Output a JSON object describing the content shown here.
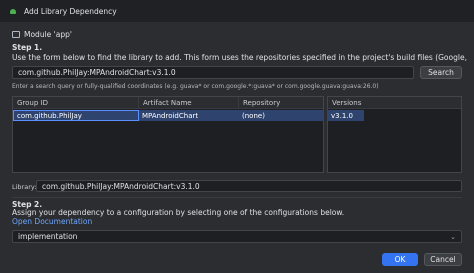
{
  "window": {
    "title": "Add Library Dependency"
  },
  "module": {
    "label": "Module 'app'"
  },
  "step1": {
    "title": "Step 1.",
    "description": "Use the form below to find the library to add. This form uses the repositories specified in the project's build files (Google, Maven Central)",
    "search_value": "com.github.PhilJay:MPAndroidChart:v3.1.0",
    "search_button": "Search",
    "hint": "Enter a search query or fully-qualified coordinates (e.g. guava* or com.google.*:guava* or com.google.guava:guava:26.0)"
  },
  "results": {
    "columns": [
      "Group ID",
      "Artifact Name",
      "Repository"
    ],
    "rows": [
      {
        "group_id": "com.github.PhilJay",
        "artifact": "MPAndroidChart",
        "repository": "(none)"
      }
    ]
  },
  "versions": {
    "header": "Versions",
    "items": [
      "v3.1.0"
    ]
  },
  "library": {
    "label": "Library:",
    "value": "com.github.PhilJay:MPAndroidChart:v3.1.0"
  },
  "step2": {
    "title": "Step 2.",
    "description": "Assign your dependency to a configuration by selecting one of the configurations below.",
    "link": "Open Documentation",
    "configuration": "implementation"
  },
  "footer": {
    "ok": "OK",
    "cancel": "Cancel"
  },
  "colors": {
    "accent": "#3574f0",
    "link": "#6ca5ff",
    "background": "#2b2d30"
  }
}
